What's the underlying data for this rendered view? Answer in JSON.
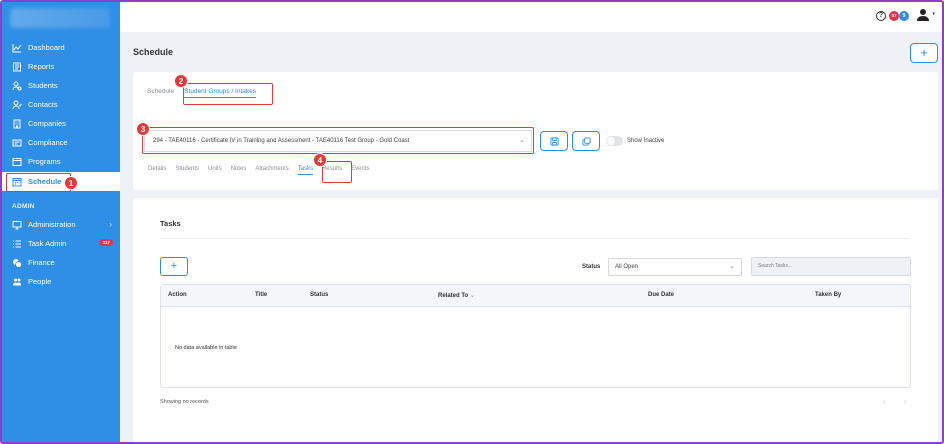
{
  "sidebar": {
    "items": [
      {
        "label": "Dashboard",
        "icon": "chart-line-icon"
      },
      {
        "label": "Reports",
        "icon": "report-icon"
      },
      {
        "label": "Students",
        "icon": "students-icon"
      },
      {
        "label": "Contacts",
        "icon": "contacts-icon"
      },
      {
        "label": "Companies",
        "icon": "building-icon"
      },
      {
        "label": "Compliance",
        "icon": "compliance-icon"
      },
      {
        "label": "Programs",
        "icon": "programs-icon"
      },
      {
        "label": "Schedule",
        "icon": "calendar-icon",
        "active": true
      }
    ],
    "admin_label": "ADMIN",
    "admin_items": [
      {
        "label": "Administration",
        "icon": "monitor-icon"
      },
      {
        "label": "Task Admin",
        "icon": "list-icon",
        "badge": "317"
      },
      {
        "label": "Finance",
        "icon": "coins-icon"
      },
      {
        "label": "People",
        "icon": "people-icon"
      }
    ]
  },
  "topbar": {
    "help": "?",
    "badge_red": "57",
    "badge_blue": "9"
  },
  "page": {
    "title": "Schedule",
    "add_label": "+"
  },
  "tabs_top": [
    "Schedule",
    "Student Groups / Intakes"
  ],
  "group_select": {
    "value": "294 - TAE40116 - Certificate IV in Training and Assessment - TAE40116 Test Group - Gold Coast",
    "caret": "⌄"
  },
  "show_inactive": "Show Inactive",
  "subtabs": [
    "Details",
    "Students",
    "Units",
    "Notes",
    "Attachments",
    "Tasks",
    "Results",
    "Events"
  ],
  "callouts": [
    "1",
    "2",
    "3",
    "4"
  ],
  "tasks": {
    "title": "Tasks",
    "add_label": "+",
    "status_label": "Status",
    "status_value": "All Open",
    "search_placeholder": "Search Tasks...",
    "columns": [
      "Action",
      "Title",
      "Status",
      "Related To",
      "Due Date",
      "Taken By"
    ],
    "sort_indicator": "⌄",
    "empty_message": "No data available in table",
    "records": "Showing no records",
    "pager": "‹ ›"
  },
  "colors": {
    "accent": "#2f8ee5",
    "callout": "#e03b3b",
    "frame": "#8a3fd1"
  }
}
